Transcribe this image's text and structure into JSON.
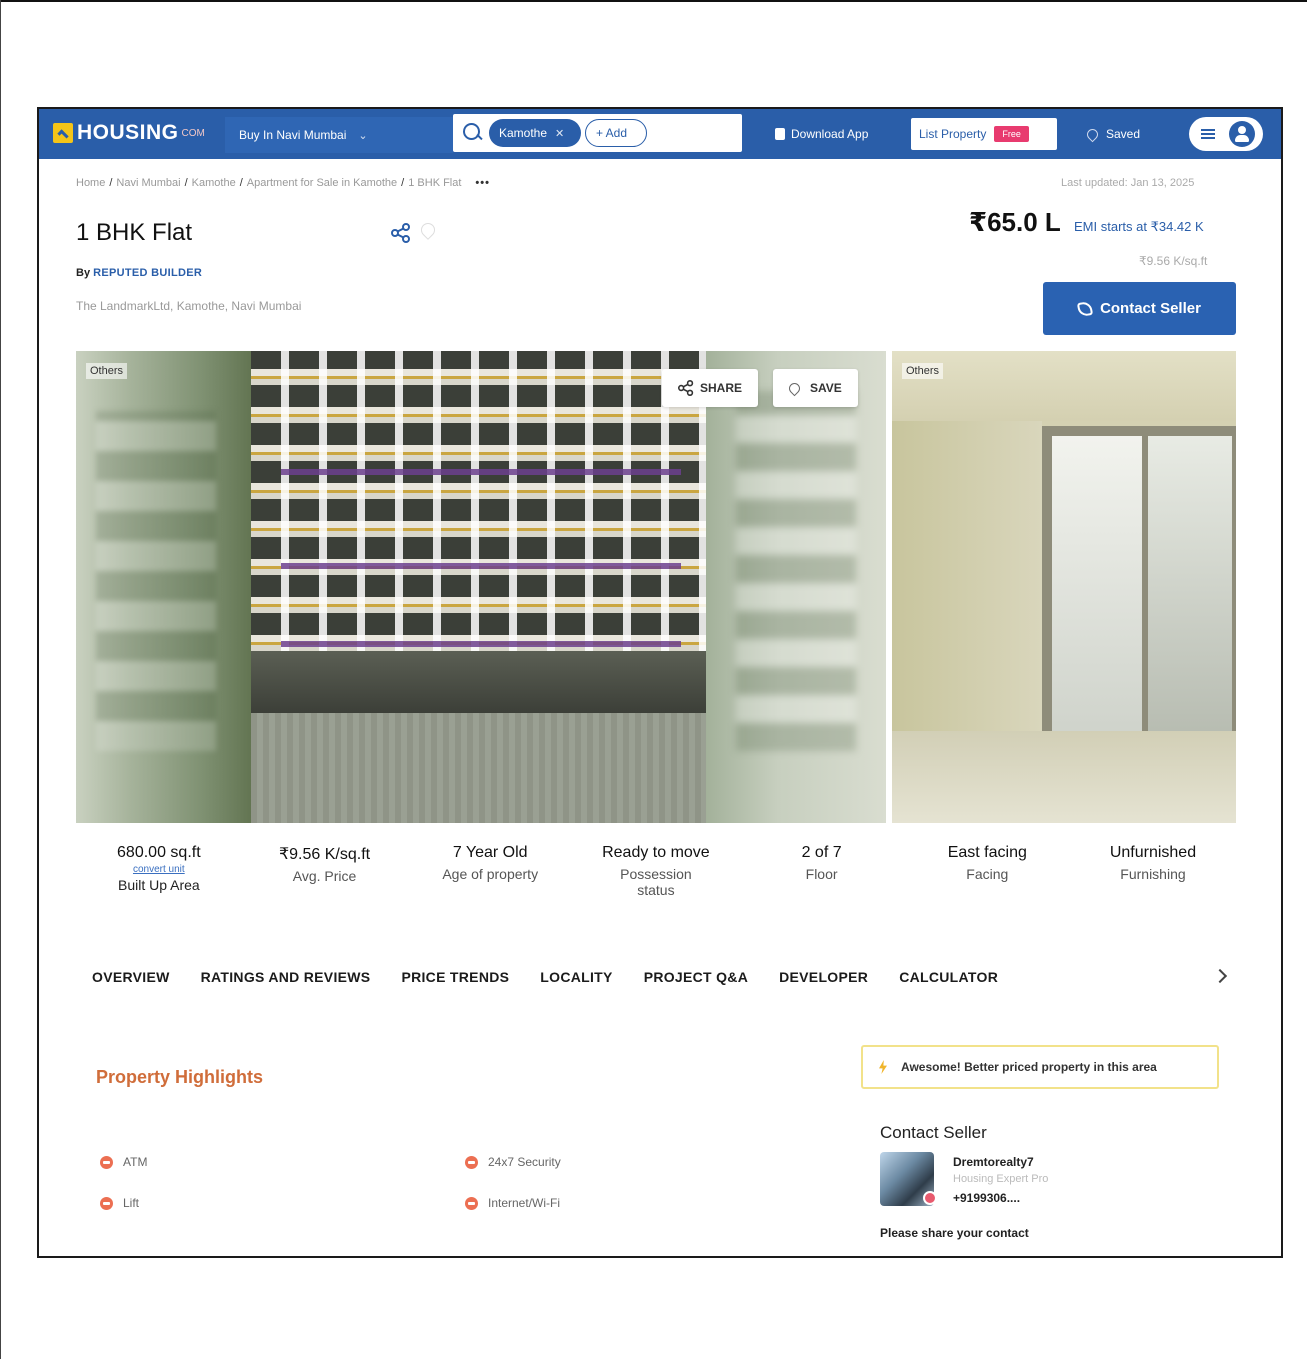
{
  "header": {
    "logo_text": "HOUSING",
    "logo_suffix": "COM",
    "city_select": "Buy In Navi Mumbai",
    "search_chip": "Kamothe",
    "add_chip": "+ Add",
    "download_app": "Download App",
    "list_property": "List Property",
    "free_badge": "Free",
    "saved": "Saved"
  },
  "breadcrumb": {
    "items": [
      "Home",
      "Navi Mumbai",
      "Kamothe",
      "Apartment for Sale in Kamothe",
      "1 BHK Flat"
    ],
    "more": "•••",
    "last_updated": "Last updated: Jan 13, 2025"
  },
  "listing": {
    "title": "1 BHK Flat",
    "by_prefix": "By",
    "builder": "REPUTED BUILDER",
    "address": "The LandmarkLtd, Kamothe, Navi Mumbai",
    "price": "₹65.0 L",
    "emi": "EMI starts at ₹34.42 K",
    "rate": "₹9.56 K/sq.ft",
    "contact_button": "Contact Seller"
  },
  "photos": {
    "main_tag": "Others",
    "side_tag": "Others",
    "share_label": "SHARE",
    "save_label": "SAVE"
  },
  "specs": [
    {
      "value": "680.00 sq.ft",
      "sub": "convert unit",
      "label": "Built Up Area"
    },
    {
      "value": "₹9.56 K/sq.ft",
      "label": "Avg. Price"
    },
    {
      "value": "7 Year Old",
      "label": "Age of property"
    },
    {
      "value": "Ready to move",
      "label": "Possession status"
    },
    {
      "value": "2 of 7",
      "label": "Floor"
    },
    {
      "value": "East facing",
      "label": "Facing"
    },
    {
      "value": "Unfurnished",
      "label": "Furnishing"
    }
  ],
  "tabs": [
    "OVERVIEW",
    "RATINGS AND REVIEWS",
    "PRICE TRENDS",
    "LOCALITY",
    "PROJECT Q&A",
    "DEVELOPER",
    "CALCULATOR"
  ],
  "highlights": {
    "title": "Property Highlights",
    "amenities": [
      "ATM",
      "24x7 Security",
      "Lift",
      "Internet/Wi-Fi"
    ]
  },
  "sidebar": {
    "promo": "Awesome! Better priced property in this area",
    "contact_title": "Contact Seller",
    "agent_name": "Dremtorealty7",
    "agent_role": "Housing Expert Pro",
    "agent_phone": "+9199306....",
    "share_prompt": "Please share your contact"
  },
  "colors": {
    "brand_blue": "#2a5ea9",
    "accent_orange": "#d06d3a",
    "badge_pink": "#e83b6f"
  }
}
